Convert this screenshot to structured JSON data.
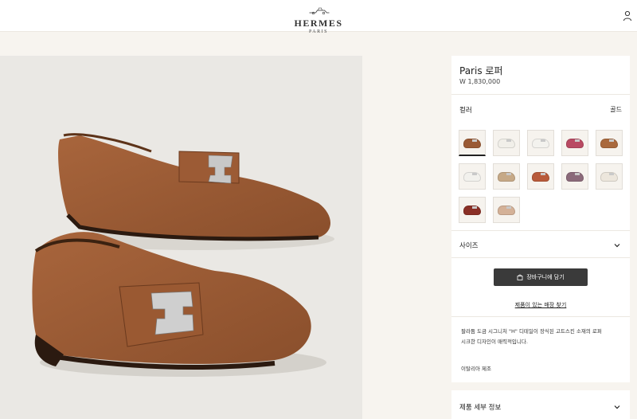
{
  "header": {
    "brand": "HERMES",
    "brand_sub": "PARIS",
    "user_icon": "user-icon"
  },
  "product": {
    "name": "Paris 로퍼",
    "price": "W 1,830,000",
    "color_label": "컬러",
    "color_value": "골드",
    "swatches": [
      {
        "color": "#9a5a35",
        "selected": true
      },
      {
        "color": "#f1efe9",
        "selected": false
      },
      {
        "color": "#f3f2ee",
        "selected": false
      },
      {
        "color": "#b94a63",
        "selected": false
      },
      {
        "color": "#a9693d",
        "selected": false
      },
      {
        "color": "#f2f1ed",
        "selected": false
      },
      {
        "color": "#c6a987",
        "selected": false
      },
      {
        "color": "#b85a3a",
        "selected": false
      },
      {
        "color": "#8b6a7a",
        "selected": false
      },
      {
        "color": "#ece6dc",
        "selected": false
      },
      {
        "color": "#8a2f26",
        "selected": false
      },
      {
        "color": "#d4b197",
        "selected": false
      }
    ],
    "size_label": "사이즈",
    "add_to_cart": "장바구니에 담기",
    "find_store": "제품이 있는 매장 찾기",
    "description_line1": "팔라듐 도금 시그니처 \"H\" 디테일이 장식된 고트스킨 소재의 로퍼",
    "description_line2": "시크한 디자인이 매력적입니다.",
    "origin": "이탈리아 제조",
    "details_label": "제품 세부 정보"
  },
  "colors": {
    "background": "#f7f4ef",
    "button": "#3a3a3a",
    "leather": "#9a5a35"
  }
}
